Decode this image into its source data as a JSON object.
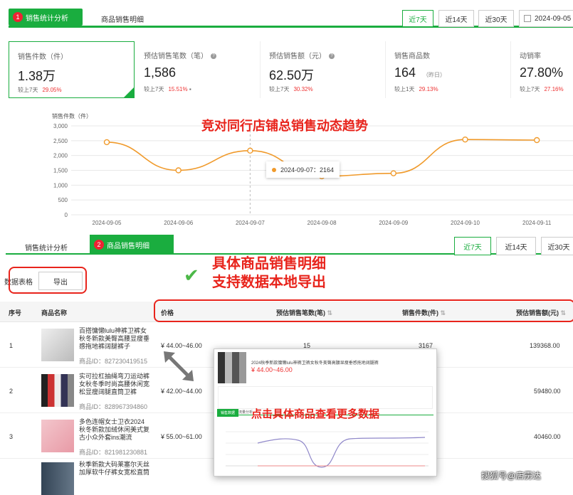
{
  "top_tabs": {
    "active_num": "1",
    "active_label": "销售统计分析",
    "other_label": "商品销售明细"
  },
  "range_buttons": {
    "d7": "近7天",
    "d14": "近14天",
    "d30": "近30天"
  },
  "date_picker": {
    "value": "2024-09-05"
  },
  "stats": [
    {
      "label": "销售件数（件）",
      "value": "1.38万",
      "cmp_label": "较上7天",
      "cmp_pct": "29.05%"
    },
    {
      "label": "预估销售笔数（笔）",
      "value": "1,586",
      "cmp_label": "较上7天",
      "cmp_pct": "15.51%"
    },
    {
      "label": "预估销售额（元）",
      "value": "62.50万",
      "cmp_label": "较上7天",
      "cmp_pct": "30.32%"
    },
    {
      "label": "销售商品数",
      "value": "164",
      "sub": "（昨日）",
      "cmp_label": "较上1天",
      "cmp_pct": "29.13%"
    },
    {
      "label": "动销率",
      "value": "27.80%",
      "cmp_label": "较上7天",
      "cmp_pct": "27.16%"
    }
  ],
  "annotations": {
    "trend": "竞对同行店铺总销售动态趋势",
    "detail_line1": "具体商品销售明细",
    "detail_line2": "支持数据本地导出",
    "click_more": "点击具体商品查看更多数据",
    "watermark": "搜狐号@店雳达"
  },
  "chart_data": {
    "type": "line",
    "ylabel": "销售件数（件）",
    "ylim": [
      0,
      3000
    ],
    "yticks": [
      "0",
      "500",
      "1,000",
      "1,500",
      "2,000",
      "2,500",
      "3,000"
    ],
    "categories": [
      "2024-09-05",
      "2024-09-06",
      "2024-09-07",
      "2024-09-08",
      "2024-09-09",
      "2024-09-10",
      "2024-09-11"
    ],
    "values": [
      2450,
      1500,
      2164,
      1300,
      1400,
      2540,
      2520
    ],
    "tooltip": "2024-09-07：2164",
    "color": "#f09a2b"
  },
  "second_tabs": {
    "first_label": "销售统计分析",
    "active_num": "2",
    "active_label": "商品销售明细"
  },
  "table_toolbar": {
    "title": "数据表格",
    "export": "导出"
  },
  "table": {
    "headers": {
      "idx": "序号",
      "name": "商品名称",
      "price": "价格",
      "orders": "预估销售笔数(笔)",
      "qty": "销售件数(件)",
      "amount": "预估销售额(元)"
    },
    "rows": [
      {
        "idx": "1",
        "title": "百搭慵懒lulu神裤卫裤女秋冬新款美臀高腰显瘦垂感拖地裤阔腿裤子",
        "id": "商品ID：827230419515",
        "price": "¥ 44.00~46.00",
        "orders": "15",
        "qty": "3167",
        "amount": "139368.00"
      },
      {
        "idx": "2",
        "title": "实可拉杠抽绳弯刀运动裤女秋冬季时尚高腰休闲宽松显瘦阔腿直筒卫裤",
        "id": "商品ID：828967394860",
        "price": "¥ 42.00~44.00",
        "orders": "",
        "qty": "",
        "amount": "59480.00"
      },
      {
        "idx": "3",
        "title": "多色连帽女士卫衣2024秋冬新款加绒休闲美式复古小众外套ins潮流",
        "id": "商品ID：821981230881",
        "price": "¥ 55.00~61.00",
        "orders": "",
        "qty": "",
        "amount": "40460.00"
      },
      {
        "idx": "",
        "title": "秋季新款大码莱塞尔天丝加厚软牛仔裤女宽松直筒",
        "id": "",
        "price": "",
        "orders": "",
        "qty": "",
        "amount": ""
      }
    ]
  },
  "popup": {
    "price": "¥ 44.00~46.00",
    "title": "2024秋季新款慵懒lulu神裤卫裤女秋冬美臀高腰显瘦垂感拖地阔腿裤",
    "tab1": "销售数据",
    "tab2": "流量分析"
  }
}
